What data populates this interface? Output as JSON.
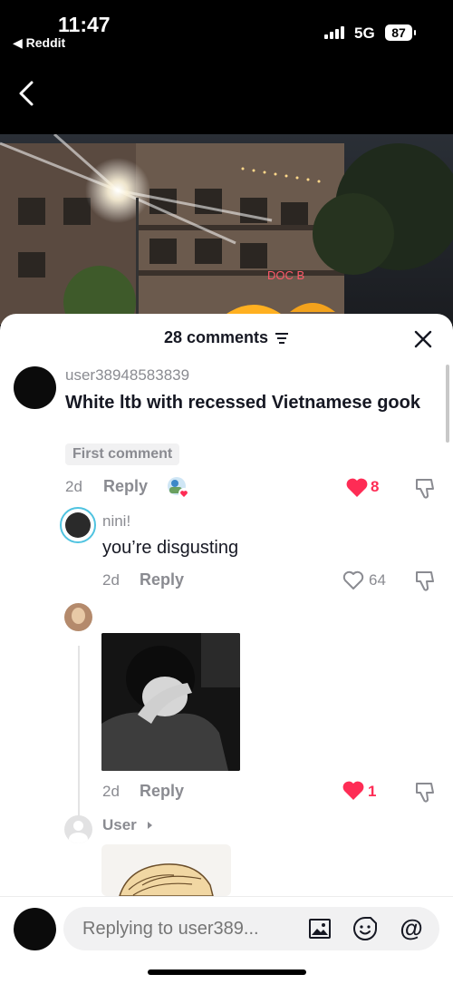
{
  "status_bar": {
    "time": "11:47",
    "back_app": "◀ Reddit",
    "network": "5G",
    "battery": "87"
  },
  "comments_header": {
    "title": "28 comments"
  },
  "comments": [
    {
      "user": "user38948583839",
      "text": "White ltb with recessed Vietnamese gook",
      "badge": "First comment",
      "age": "2d",
      "reply_label": "Reply",
      "likes": "8"
    }
  ],
  "replies": [
    {
      "user": "nini!",
      "text": "you’re disgusting",
      "age": "2d",
      "reply_label": "Reply",
      "likes": "64"
    },
    {
      "user": "",
      "age": "2d",
      "reply_label": "Reply",
      "likes": "1"
    },
    {
      "user": "User"
    }
  ],
  "input": {
    "placeholder": "Replying to user389..."
  },
  "colors": {
    "accent": "#fe2c55",
    "muted": "#8a8b91",
    "text": "#161823"
  }
}
